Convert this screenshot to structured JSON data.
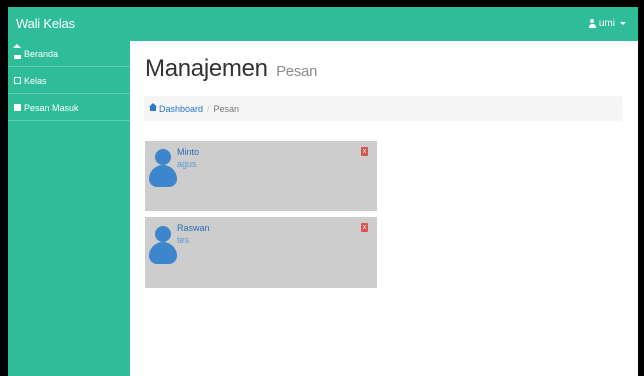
{
  "topbar": {
    "brand": "Wali Kelas",
    "user_name": "umi"
  },
  "sidebar": {
    "items": [
      {
        "label": "Beranda",
        "icon": "home-icon"
      },
      {
        "label": "Kelas",
        "icon": "box-icon"
      },
      {
        "label": "Pesan Masuk",
        "icon": "message-icon"
      }
    ]
  },
  "main": {
    "title": "Manajemen",
    "subtitle": "Pesan",
    "breadcrumb": {
      "home": "Dashboard",
      "current": "Pesan"
    },
    "messages": [
      {
        "sender": "Minto",
        "text": "agus",
        "delete_label": "x"
      },
      {
        "sender": "Raswan",
        "text": "tes",
        "delete_label": "x"
      }
    ]
  },
  "colors": {
    "accent": "#2ebd98",
    "link": "#2a7ac9",
    "avatar": "#3d85cc",
    "danger": "#d9534f",
    "card_bg": "#cdcdcd"
  }
}
